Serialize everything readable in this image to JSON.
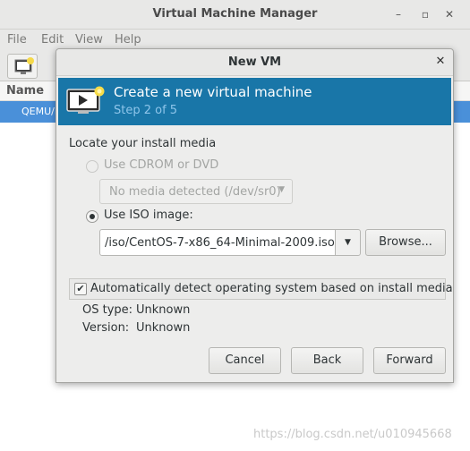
{
  "main_window": {
    "title": "Virtual Machine Manager",
    "controls": {
      "minimize": "–",
      "maximize": "▫",
      "close": "✕"
    },
    "menu": [
      "File",
      "Edit",
      "View",
      "Help"
    ],
    "list_header": "Name",
    "list_row": "QEMU/K"
  },
  "dialog": {
    "title": "New VM",
    "close": "✕",
    "header": {
      "title": "Create a new virtual machine",
      "step": "Step 2 of 5"
    },
    "locate_label": "Locate your install media",
    "cdrom_option": "Use CDROM or DVD",
    "cdrom_combo": "No media detected (/dev/sr0)",
    "iso_option": "Use ISO image:",
    "iso_path": "/iso/CentOS-7-x86_64-Minimal-2009.iso",
    "browse": "Browse...",
    "autodetect": {
      "checked": true,
      "label": "Automatically detect operating system based on install media",
      "checkmark": "✔"
    },
    "os_type_label": "OS type:",
    "os_type_value": "Unknown",
    "version_label": "Version:",
    "version_value": "Unknown",
    "buttons": {
      "cancel": "Cancel",
      "back": "Back",
      "forward": "Forward"
    },
    "arrow": "▼"
  },
  "watermark": "https://blog.csdn.net/u010945668",
  "colors": {
    "header_bg": "#1976a8",
    "header_step": "#8ec5ea",
    "selection": "#4a90d9"
  }
}
